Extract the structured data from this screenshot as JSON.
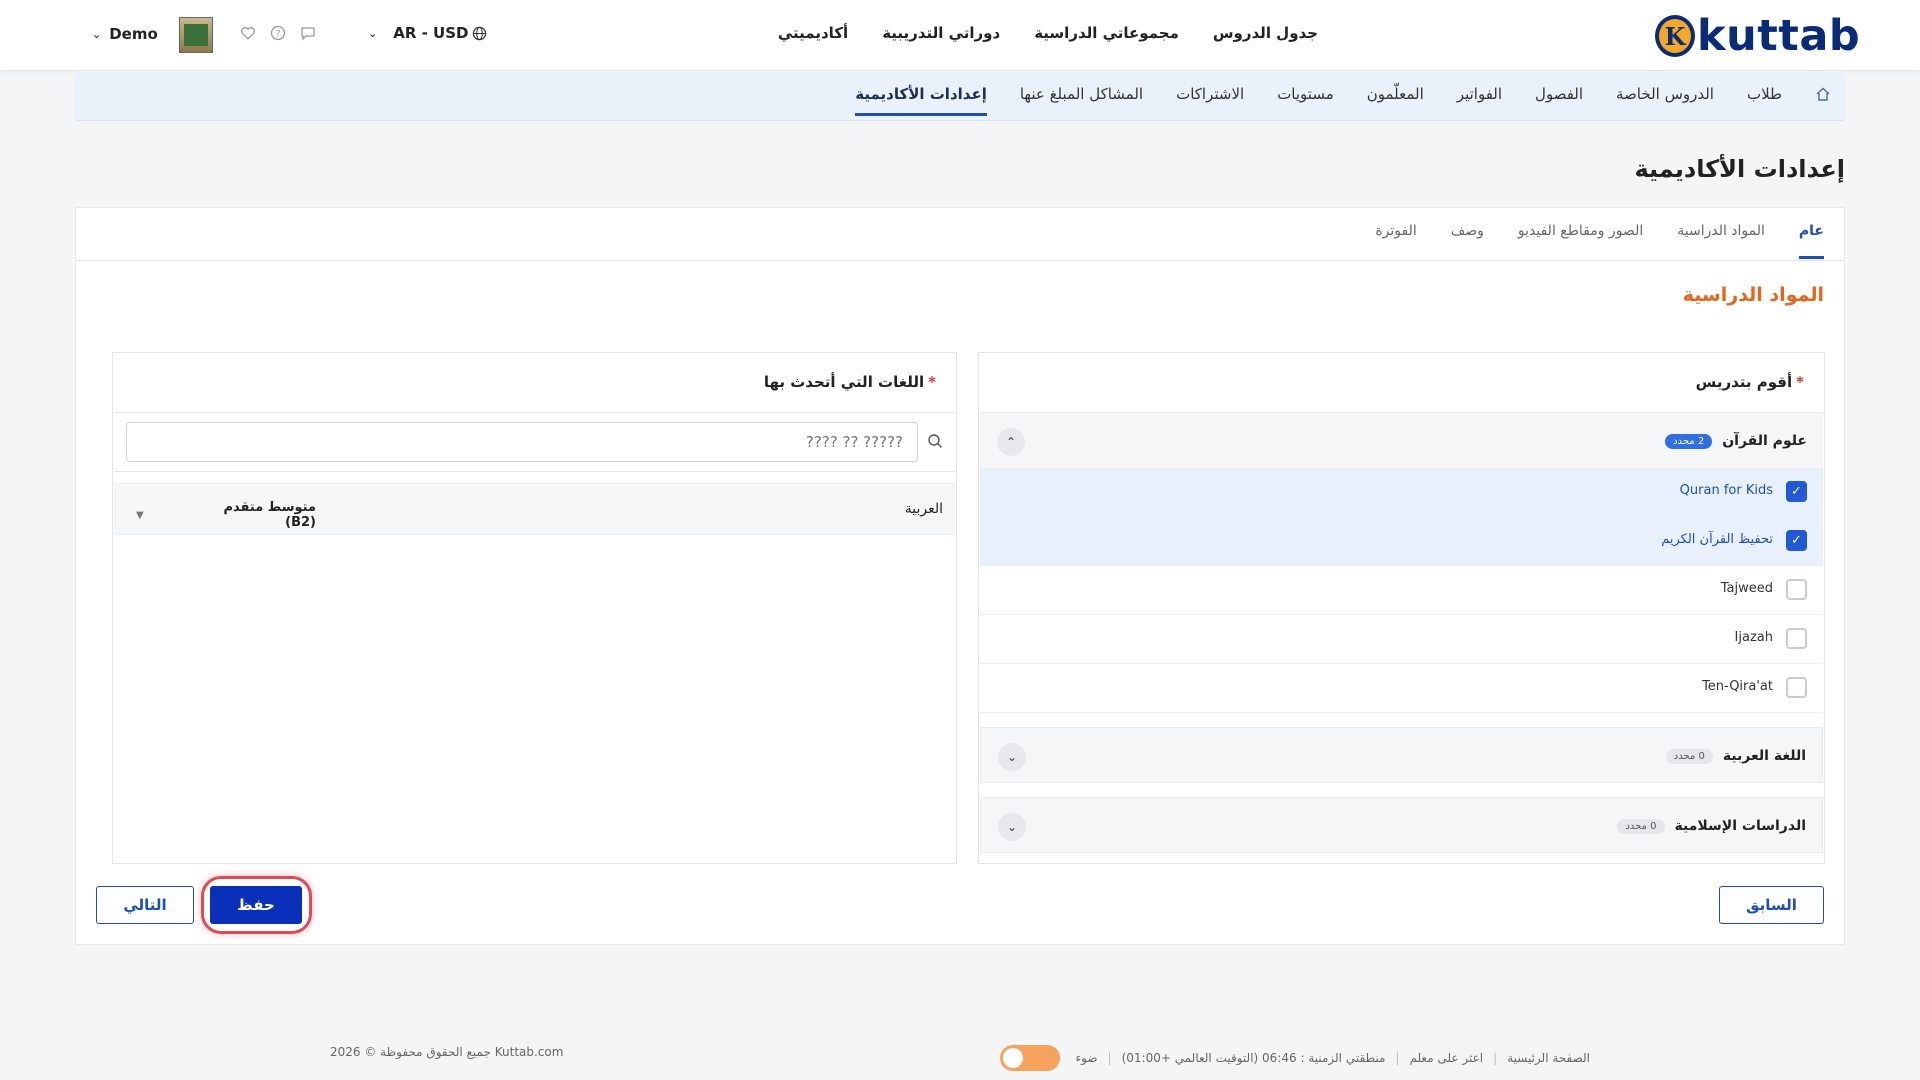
{
  "header": {
    "logo_text": "kuttab",
    "logo_mark": "K",
    "nav": [
      "جدول الدروس",
      "مجموعاتي الدراسية",
      "دوراتي التدريبية",
      "أكاديميتي"
    ],
    "lang_currency": "AR - USD",
    "user_name": "Demo"
  },
  "subnav": {
    "items": [
      "طلاب",
      "الدروس الخاصة",
      "الفصول",
      "الفواتير",
      "المعلّمون",
      "مستويات",
      "الاشتراكات",
      "المشاكل المبلغ عنها",
      "إعدادات الأكاديمية"
    ],
    "active": "إعدادات الأكاديمية"
  },
  "page_title": "إعدادات الأكاديمية",
  "tabs": [
    "عام",
    "المواد الدراسية",
    "الصور ومقاطع الفيديو",
    "وصف",
    "الفوترة"
  ],
  "section_title": "المواد الدراسية",
  "subjects_panel": {
    "title": "أقوم بتدريس",
    "required_mark": "*",
    "groups": [
      {
        "title": "علوم القرآن",
        "badge": "2 محدد",
        "expanded": true,
        "items": [
          {
            "label": "Quran for Kids",
            "checked": true
          },
          {
            "label": "تحفيظ القرآن الكريم",
            "checked": true
          },
          {
            "label": "Tajweed",
            "checked": false
          },
          {
            "label": "Ijazah",
            "checked": false
          },
          {
            "label": "Ten-Qira'at",
            "checked": false
          }
        ]
      },
      {
        "title": "اللغة العربية",
        "badge": "0 محدد",
        "expanded": false
      },
      {
        "title": "الدراسات الإسلامية",
        "badge": "0 محدد",
        "expanded": false
      }
    ]
  },
  "languages_panel": {
    "title": "اللغات التي أتحدث بها",
    "required_mark": "*",
    "search_placeholder": "????? ?? ????",
    "rows": [
      {
        "language": "العربية",
        "level": "متوسط متقدم (B2)"
      }
    ]
  },
  "buttons": {
    "prev": "السابق",
    "next": "التالي",
    "save": "حفظ"
  },
  "footer": {
    "home": "الصفحة الرئيسية",
    "become_teacher": "اعثر على معلم",
    "timezone": "منطقتي الزمنية : 06:46 (التوقيت العالمي +01:00)",
    "theme_label": "ضوء",
    "copyright": "جميع الحقوق محفوظة © 2026 Kuttab.com"
  },
  "colors": {
    "brand": "#0a2b78",
    "accent": "#1e4fb5",
    "section_title": "#e8641b",
    "highlight_ring": "#e04a55"
  }
}
